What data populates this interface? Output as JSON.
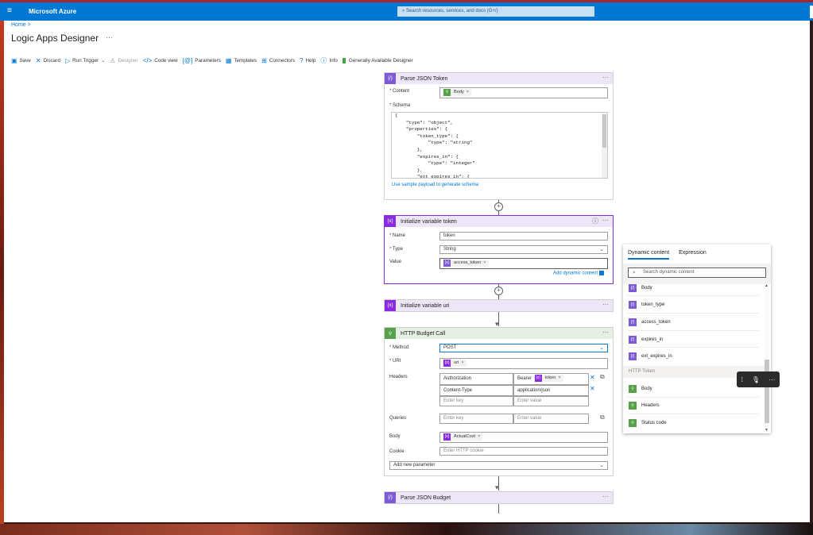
{
  "topbar": {
    "menu_icon": "hamburger-icon",
    "brand": "Microsoft Azure",
    "search_placeholder": "Search resources, services, and docs (G+/)"
  },
  "breadcrumb": {
    "home": "Home",
    "sep": ">"
  },
  "page": {
    "title": "Logic Apps Designer",
    "more": "···"
  },
  "toolbar": {
    "save": "Save",
    "discard": "Discard",
    "run_trigger": "Run Trigger",
    "designer": "Designer",
    "code_view": "Code view",
    "parameters": "Parameters",
    "templates": "Templates",
    "connectors": "Connectors",
    "help": "Help",
    "info": "Info",
    "ga_designer": "Generally Available Designer"
  },
  "parse_json_token": {
    "title": "Parse JSON Token",
    "content_label": "Content",
    "content_chip": "Body",
    "schema_label": "Schema",
    "schema_lines": [
      "{",
      "    \"type\": \"object\",",
      "    \"properties\": {",
      "        \"token_type\": {",
      "            \"type\": \"string\"",
      "        },",
      "        \"expires_in\": {",
      "            \"type\": \"integer\"",
      "        },",
      "        \"ext_expires_in\": {"
    ],
    "sample_link": "Use sample payload to generate schema"
  },
  "init_token": {
    "title": "Initialize variable token",
    "name_label": "Name",
    "name_value": "token",
    "type_label": "Type",
    "type_value": "String",
    "value_label": "Value",
    "value_chip": "access_token",
    "add_dynamic": "Add dynamic content"
  },
  "init_uri": {
    "title": "Initialize variable uri"
  },
  "http_call": {
    "title": "HTTP Budget Call",
    "method_label": "Method",
    "method_value": "POST",
    "uri_label": "URI",
    "uri_chip": "uri",
    "headers_label": "Headers",
    "headers": [
      {
        "key": "Authorization",
        "value_prefix": "Bearer",
        "value_chip": "token"
      },
      {
        "key": "Content-Type",
        "value": "application/json"
      }
    ],
    "enter_key": "Enter key",
    "enter_value": "Enter value",
    "queries_label": "Queries",
    "body_label": "Body",
    "body_chip": "ActualCost",
    "cookie_label": "Cookie",
    "cookie_placeholder": "Enter HTTP cookie",
    "add_param": "Add new parameter"
  },
  "parse_json_budget": {
    "title": "Parse JSON Budget"
  },
  "dynamic_panel": {
    "tab_dynamic": "Dynamic content",
    "tab_expression": "Expression",
    "search_placeholder": "Search dynamic content",
    "items_a": [
      "Body",
      "token_type",
      "access_token",
      "expires_in",
      "ext_expires_in"
    ],
    "section": "HTTP Token",
    "items_b": [
      "Body",
      "Headers",
      "Status code"
    ]
  },
  "colors": {
    "azure_blue": "#0078d4",
    "variable_purple": "#8a2be2",
    "http_green": "#56a14a"
  }
}
